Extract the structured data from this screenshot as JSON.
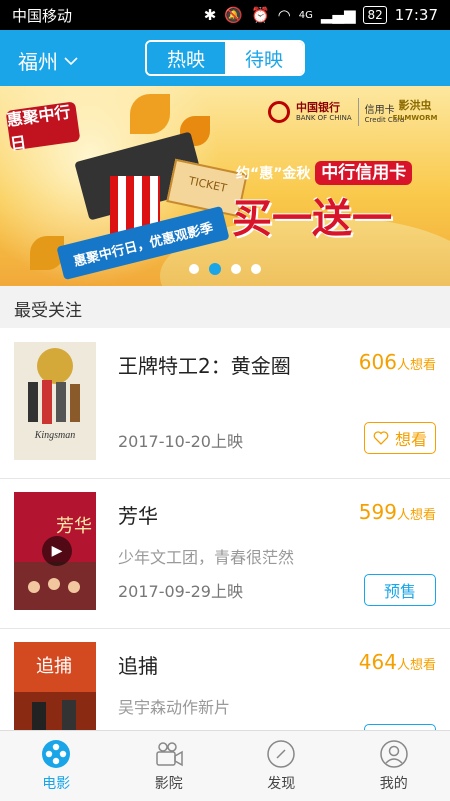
{
  "status_bar": {
    "carrier": "中国移动",
    "signal": "4G",
    "battery": "82",
    "time": "17:37"
  },
  "header": {
    "city": "福州",
    "tabs": [
      {
        "label": "热映",
        "active": true
      },
      {
        "label": "待映",
        "active": false
      }
    ]
  },
  "banner": {
    "tag": "惠聚中行日",
    "bank_name": "中国银行",
    "bank_en": "BANK OF CHINA",
    "card_label": "信用卡",
    "card_en": "Credit Card",
    "partner": "影洪虫",
    "partner_en": "FILMWORM",
    "ribbon": "惠聚中行日，优惠观影季",
    "promo_line": "约“惠”金秋",
    "promo_highlight": "中行信用卡",
    "promo_main": "买一送一",
    "ticket_text": "TICKET",
    "active_dot": 1,
    "dots_count": 4
  },
  "section": {
    "title": "最受关注"
  },
  "movies": [
    {
      "title": "王牌特工2：黄金圈",
      "want_count": "606",
      "want_unit": "人想看",
      "subtitle": "",
      "date": "2017-10-20上映",
      "button": "想看",
      "button_type": "wish",
      "poster_text": "Kingsman"
    },
    {
      "title": "芳华",
      "want_count": "599",
      "want_unit": "人想看",
      "subtitle": "少年文工团，青春很茫然",
      "date": "2017-09-29上映",
      "button": "预售",
      "button_type": "sale",
      "poster_text": "芳华"
    },
    {
      "title": "追捕",
      "want_count": "464",
      "want_unit": "人想看",
      "subtitle": "吴宇森动作新片",
      "date": "",
      "button": "",
      "button_type": "sale",
      "poster_text": "追捕"
    }
  ],
  "tabbar": [
    {
      "label": "电影",
      "icon": "film-reel-icon",
      "active": true
    },
    {
      "label": "影院",
      "icon": "camera-icon",
      "active": false
    },
    {
      "label": "发现",
      "icon": "compass-icon",
      "active": false
    },
    {
      "label": "我的",
      "icon": "user-icon",
      "active": false
    }
  ],
  "colors": {
    "accent": "#1aa5e8",
    "want": "#f5a000",
    "promo_red": "#d8142a"
  }
}
